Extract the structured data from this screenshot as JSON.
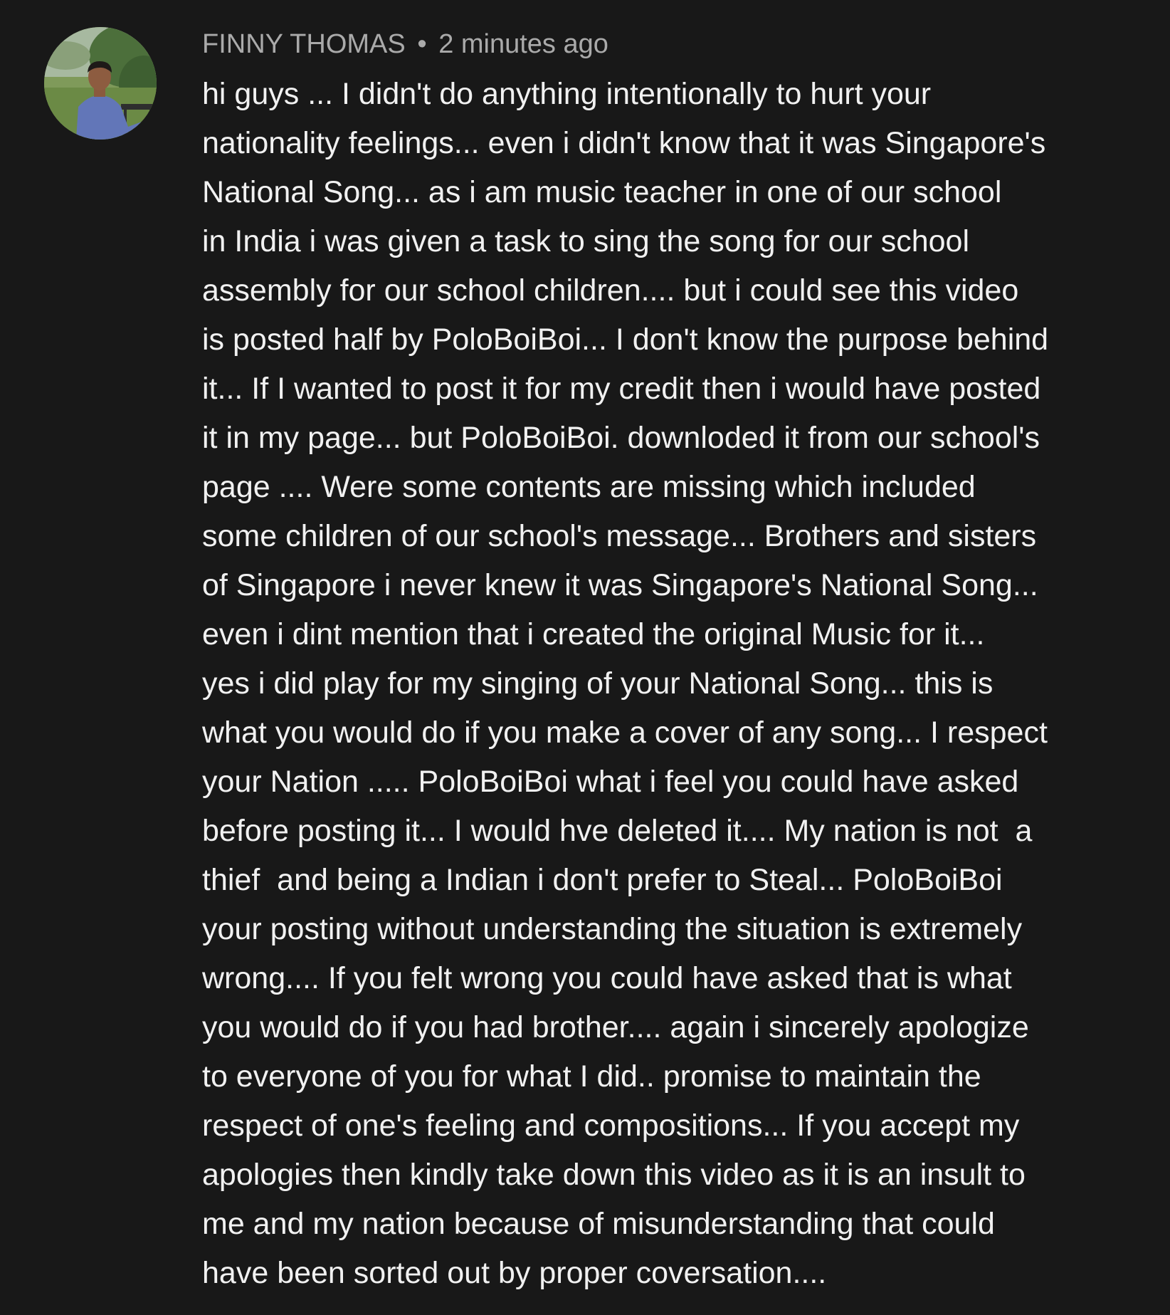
{
  "comment": {
    "author": "FINNY THOMAS",
    "separator": "•",
    "timestamp": "2 minutes ago",
    "avatar_icon": "user-avatar-icon",
    "lines": [
      "hi guys ... I didn't do anything intentionally to hurt your",
      "nationality feelings... even i didn't know that it was Singapore's",
      "National Song... as i am music teacher in one of our school",
      "in India i was given a task to sing the song for our school",
      "assembly for our school children.... but i could see this video",
      "is posted half by PoloBoiBoi... I don't know the purpose behind",
      "it... If I wanted to post it for my credit then i would have posted",
      "it in my page... but PoloBoiBoi. downloded it from our school's",
      "page .... Were some contents are missing which included",
      "some children of our school's message... Brothers and sisters",
      "of Singapore i never knew it was Singapore's National Song...",
      "even i dint mention that i created the original Music for it...",
      "yes i did play for my singing of your National Song... this is",
      "what you would do if you make a cover of any song... I respect",
      "your Nation ..... PoloBoiBoi what i feel you could have asked",
      "before posting it... I would hve deleted it.... My nation is not  a",
      "thief  and being a Indian i don't prefer to Steal... PoloBoiBoi",
      "your posting without understanding the situation is extremely",
      "wrong.... If you felt wrong you could have asked that is what",
      "you would do if you had brother.... again i sincerely apologize",
      "to everyone of you for what I did.. promise to maintain the",
      "respect of one's feeling and compositions... If you accept my",
      "apologies then kindly take down this video as it is an insult to",
      "me and my nation because of misunderstanding that could",
      "have been sorted out by proper coversation...."
    ]
  },
  "colors": {
    "background": "#181818",
    "author": "#aaaaaa",
    "text": "#f1f1f1"
  }
}
